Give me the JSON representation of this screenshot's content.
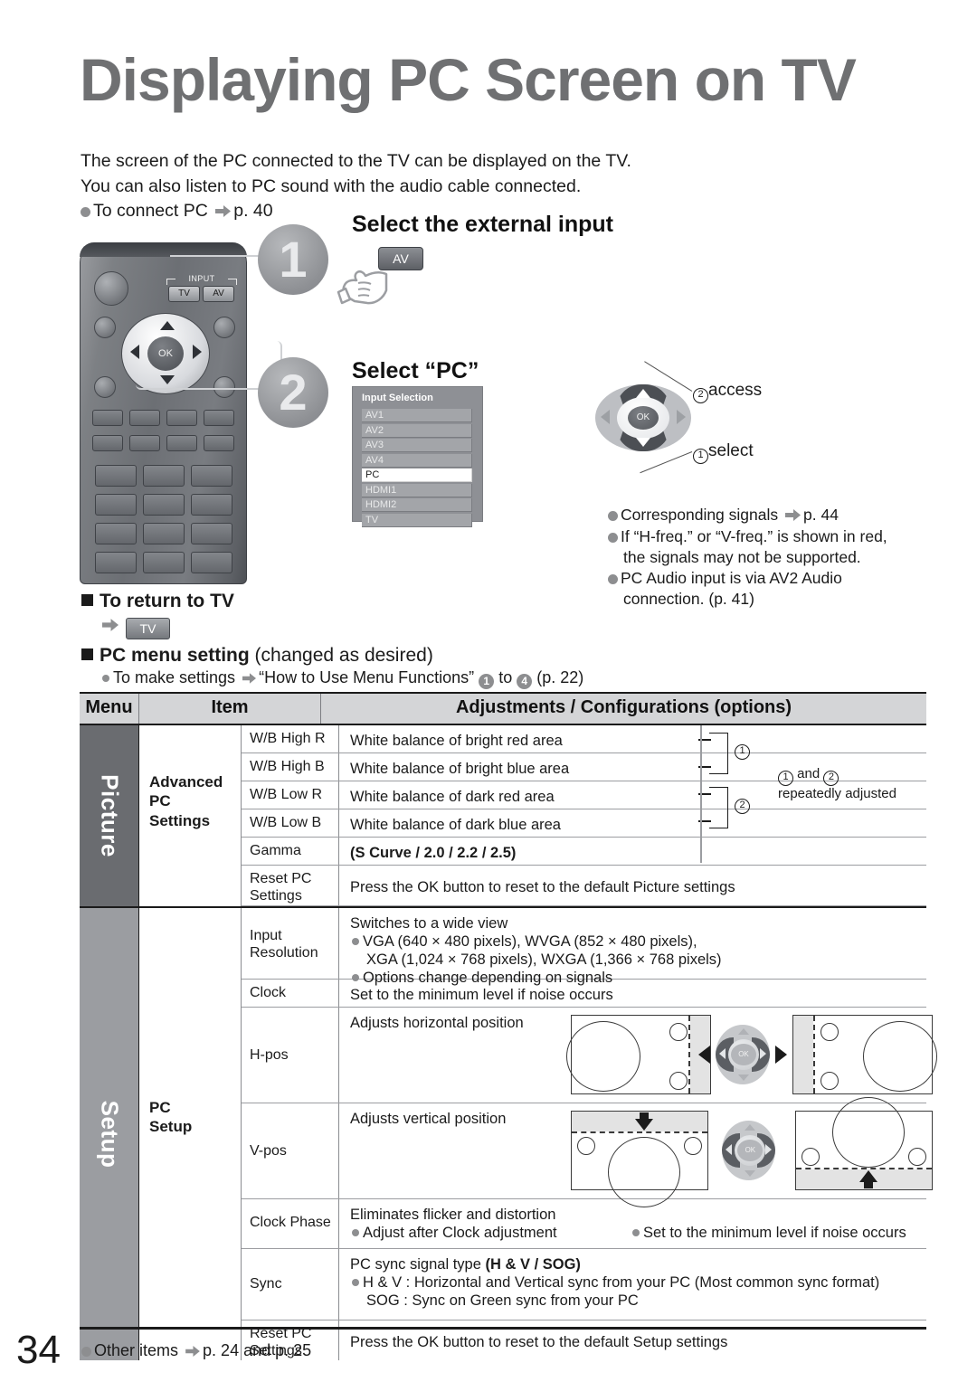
{
  "page": {
    "number": "34",
    "title": "Displaying PC Screen on TV",
    "footnote": "Other items",
    "footnote_ref": "p. 24 and p. 25"
  },
  "intro": {
    "line1": "The screen of the PC connected to the TV can be displayed on the TV.",
    "line2": "You can also listen to PC sound with the audio cable connected.",
    "bullet": "To connect PC",
    "bullet_ref": "p. 40"
  },
  "remote": {
    "input_label": "INPUT",
    "tv_button": "TV",
    "av_button": "AV",
    "ok_button": "OK"
  },
  "steps": [
    {
      "number": "1",
      "heading": "Select the external input",
      "key": "AV"
    },
    {
      "number": "2",
      "heading": "Select “PC”"
    }
  ],
  "osd": {
    "title": "Input Selection",
    "items": [
      "AV1",
      "AV2",
      "AV3",
      "AV4",
      "PC",
      "HDMI1",
      "HDMI2",
      "TV"
    ],
    "selected": "PC"
  },
  "dpad_callouts": {
    "access_num": "2",
    "access": "access",
    "select_num": "1",
    "select": "select",
    "ok": "OK"
  },
  "notes": [
    {
      "text": "Corresponding signals",
      "ref": "p. 44",
      "cont": ""
    },
    {
      "text": "If “H-freq.” or “V-freq.” is shown in red,",
      "ref": "",
      "cont": "the signals may not be supported."
    },
    {
      "text": "PC Audio input is via AV2 Audio",
      "ref": "",
      "cont": "connection. (p. 41)"
    }
  ],
  "return_to_tv": {
    "heading": "To return to TV",
    "key": "TV"
  },
  "pc_menu_setting": {
    "heading": "PC menu setting",
    "heading_sub": "(changed as desired)",
    "sub": "To make settings",
    "sub_ref": "“How to Use Menu Functions”",
    "sub_num1": "1",
    "sub_to": "to",
    "sub_num4": "4",
    "sub_page": "(p. 22)"
  },
  "table": {
    "headers": {
      "menu": "Menu",
      "item": "Item",
      "adjustments": "Adjustments / Configurations (options)"
    },
    "groups": [
      {
        "menu": "Picture",
        "item": "Advanced\nPC\nSettings",
        "item_lines": [
          "Advanced",
          "PC",
          "Settings"
        ],
        "rows": [
          {
            "name": "W/B High R",
            "desc": "White balance of bright red area"
          },
          {
            "name": "W/B High B",
            "desc": "White balance of bright blue area"
          },
          {
            "name": "W/B Low R",
            "desc": "White balance of dark red area"
          },
          {
            "name": "W/B Low B",
            "desc": "White balance of dark blue area"
          },
          {
            "name": "Gamma",
            "desc": "(S Curve / 2.0 / 2.2 / 2.5)",
            "bold": true
          },
          {
            "name": "Reset PC Settings",
            "name_lines": [
              "Reset PC",
              "Settings"
            ],
            "desc": "Press the OK button to reset to the default Picture settings"
          }
        ],
        "annotation": {
          "bracket1": "1",
          "bracket2": "2",
          "note_num1": "1",
          "note_and": "and",
          "note_num2": "2",
          "note_line2": "repeatedly adjusted"
        }
      },
      {
        "menu": "Setup",
        "item": "PC\nSetup",
        "item_lines": [
          "PC",
          "Setup"
        ],
        "rows": [
          {
            "name": "Input Resolution",
            "name_lines": [
              "Input",
              "Resolution"
            ],
            "desc": "Switches to a wide view",
            "subs": [
              "VGA (640 × 480 pixels), WVGA (852 × 480 pixels),",
              "XGA (1,024 × 768 pixels), WXGA (1,366 × 768 pixels)",
              "Options change depending on signals"
            ]
          },
          {
            "name": "Clock",
            "desc": "Set to the minimum level if noise occurs"
          },
          {
            "name": "H-pos",
            "desc": "Adjusts horizontal position",
            "diagram": "hpos"
          },
          {
            "name": "V-pos",
            "desc": "Adjusts vertical position",
            "diagram": "vpos"
          },
          {
            "name": "Clock Phase",
            "desc": "Eliminates flicker and distortion",
            "subs": [
              "Adjust after Clock adjustment",
              "Set to the minimum level if noise occurs"
            ]
          },
          {
            "name": "Sync",
            "desc": "PC sync signal type (H & V / SOG)",
            "desc_plain": "PC sync signal type ",
            "desc_bold": "(H & V / SOG)",
            "subs": [
              "H & V : Horizontal and Vertical sync from your PC (Most common sync format)",
              "SOG  : Sync on Green sync from your PC"
            ]
          },
          {
            "name": "Reset PC Settings",
            "name_lines": [
              "Reset PC",
              "Settings"
            ],
            "desc": "Press the OK button to reset to the default Setup settings"
          }
        ]
      }
    ]
  },
  "colors": {
    "title_gray": "#6f7072",
    "picture_band": "#6a6c70",
    "setup_band": "#9b9da1",
    "header_bg": "#d4d5d7",
    "osd_bg": "#8e9095",
    "osd_item": "#a3a5a9",
    "bullet": "#8d8e90"
  }
}
